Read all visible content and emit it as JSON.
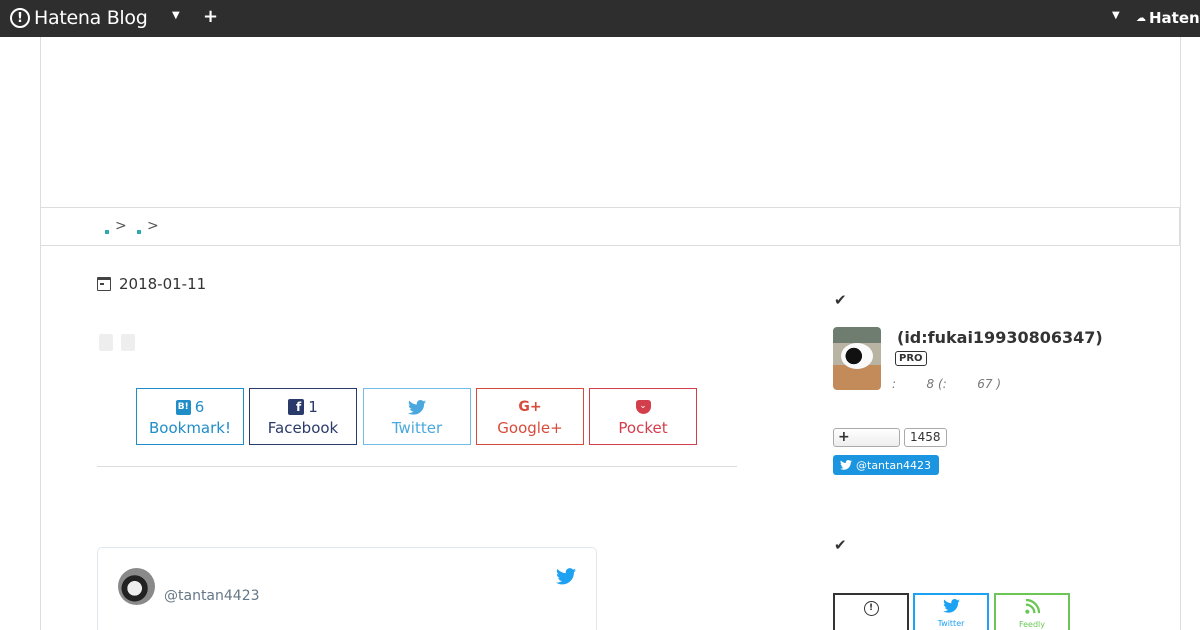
{
  "topbar": {
    "logo_text": "Hatena Blog",
    "right_label": "Haten"
  },
  "breadcrumb": {
    "separator": ">"
  },
  "entry": {
    "date": "2018-01-11"
  },
  "share": {
    "bookmark": {
      "count": "6",
      "label": "Bookmark!"
    },
    "facebook": {
      "count": "1",
      "label": "Facebook"
    },
    "twitter": {
      "label": "Twitter"
    },
    "googleplus": {
      "icon_text": "G+",
      "label": "Google+"
    },
    "pocket": {
      "label": "Pocket"
    }
  },
  "twitter_card": {
    "handle": "@tantan4423"
  },
  "sidebar": {
    "profile": {
      "id": "(id:fukai19930806347)",
      "badge": "PRO",
      "stats": ":        8 (:        67 )"
    },
    "follow_count": "1458",
    "twitter_follow": "@tantan4423",
    "subscribe": {
      "twitter": "Twitter",
      "feedly": "Feedly"
    }
  },
  "colors": {
    "topbar": "#2e2e2e",
    "bookmark": "#1f8dc8",
    "facebook": "#2a3a6a",
    "twitter": "#4aa8de",
    "googleplus": "#d64b3b",
    "pocket": "#d33e4c",
    "feedly": "#6cc655"
  }
}
